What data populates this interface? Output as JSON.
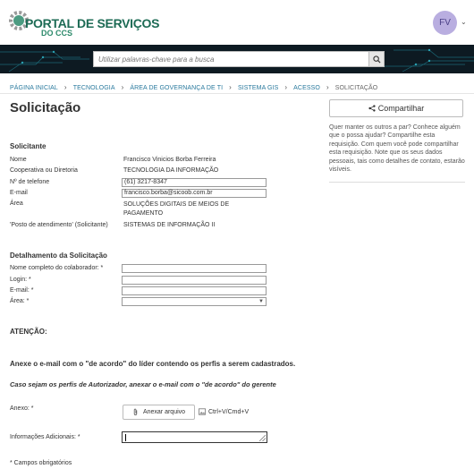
{
  "header": {
    "logo_text": "PORTAL DE SERVIÇOS",
    "logo_sub": "DO CCS",
    "avatar_initials": "FV"
  },
  "search": {
    "placeholder": "Utilizar palavras-chave para a busca"
  },
  "breadcrumb": [
    "PÁGINA INICIAL",
    "TECNOLOGIA",
    "ÁREA DE GOVERNANÇA DE TI",
    "SISTEMA GIS",
    "ACESSO",
    "SOLICITAÇÃO"
  ],
  "page": {
    "title": "Solicitação"
  },
  "share": {
    "button_label": "Compartilhar",
    "description": "Quer manter os outros a par? Conhece alguém que o possa ajudar? Compartilhe esta requisição. Com quem você pode compartilhar esta requisição. Note que os seus dados pessoais, tais como detalhes de contato, estarão visíveis."
  },
  "requester": {
    "section_title": "Solicitante",
    "name_label": "Nome",
    "name_value": "Francisco Vinicios Borba Ferreira",
    "coop_label": "Cooperativa ou Diretoria",
    "coop_value": "TECNOLOGIA DA INFORMAÇÃO",
    "phone_label": "Nº de telefone",
    "phone_value": "(61) 3217-8347",
    "email_label": "E-mail",
    "email_value": "francisco.borba@sicoob.com.br",
    "area_label": "Área",
    "area_value_1": "SOLUÇÕES DIGITAIS DE MEIOS DE",
    "area_value_2": "PAGAMENTO",
    "post_label": "'Posto de atendimento' (Solicitante)",
    "post_value": "SISTEMAS DE INFORMAÇÃO II"
  },
  "details": {
    "section_title": "Detalhamento da Solicitação",
    "fullname_label": "Nome completo do colaborador: *",
    "login_label": "Login: *",
    "email_label": "E-mail: *",
    "area_label": "Área: *",
    "fullname_value": "",
    "login_value": "",
    "email_value": "",
    "area_value": ""
  },
  "notes": {
    "attention": "ATENÇÃO:",
    "attach_instruction": "Anexe o e-mail com o \"de acordo\" do líder contendo os perfis a serem cadastrados.",
    "authorizer_instruction": "Caso sejam os perfis de Autorizador, anexar o e-mail com o \"de acordo\" do gerente"
  },
  "attachments": {
    "label": "Anexo: *",
    "button_label": "Anexar arquivo",
    "paste_hint": "Ctrl+V/Cmd+V"
  },
  "additional": {
    "label": "Informações Adicionais: *",
    "value": ""
  },
  "footer": {
    "required_note": "* Campos obrigatórios"
  },
  "colors": {
    "link": "#2a7a9e",
    "brand": "#1d6b55",
    "banner": "#0d1a22",
    "avatar_bg": "#b9aee0"
  }
}
